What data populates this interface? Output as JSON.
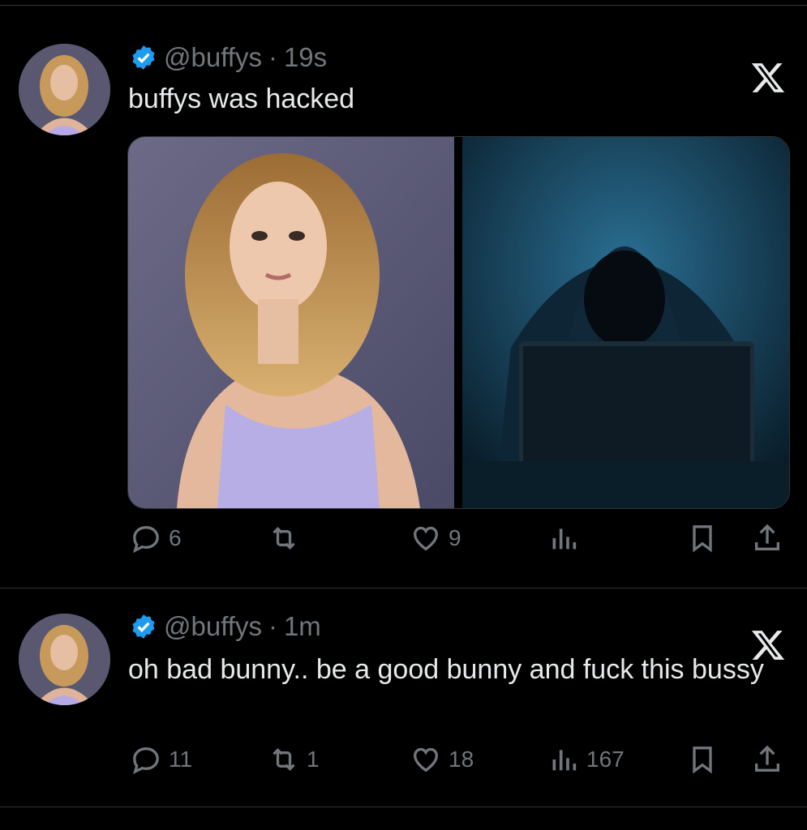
{
  "tweets": [
    {
      "handle": "@buffys",
      "separator": "·",
      "time": "19s",
      "text": "buffys was hacked",
      "stats": {
        "replies": "6",
        "reposts": "",
        "likes": "9",
        "views": ""
      }
    },
    {
      "handle": "@buffys",
      "separator": "·",
      "time": "1m",
      "text": "oh bad bunny.. be a good bunny and fuck this bussy",
      "stats": {
        "replies": "11",
        "reposts": "1",
        "likes": "18",
        "views": "167"
      }
    }
  ],
  "colors": {
    "background": "#000000",
    "text": "#e7e9ea",
    "muted": "#71767b",
    "verified": "#1d9bf0",
    "divider": "#2f3336"
  },
  "icons": [
    "verified-badge-icon",
    "x-logo-icon",
    "reply-icon",
    "repost-icon",
    "like-icon",
    "views-icon",
    "bookmark-icon",
    "share-icon"
  ]
}
